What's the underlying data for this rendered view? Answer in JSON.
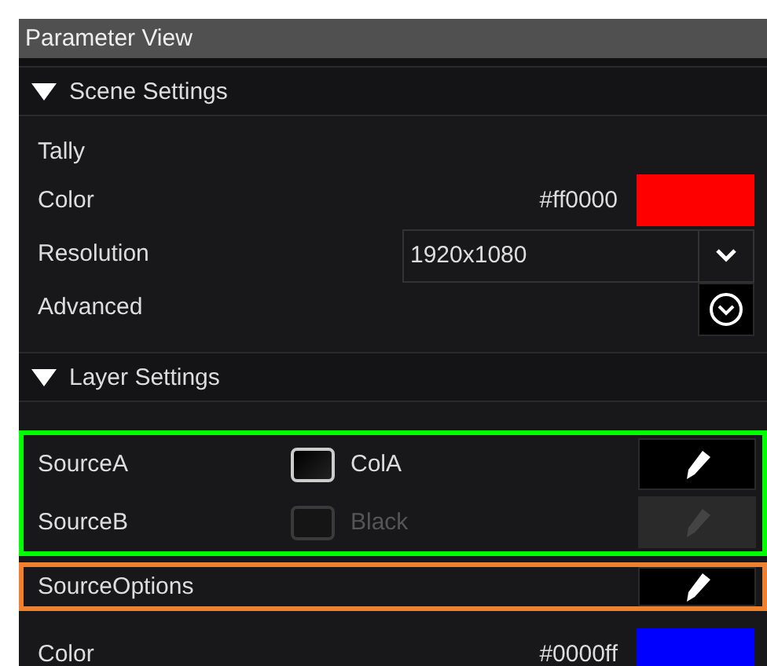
{
  "panel_title": "Parameter View",
  "sections": [
    {
      "title": "Scene Settings",
      "expanded": true,
      "rows": [
        {
          "kind": "label",
          "label": "Tally"
        },
        {
          "kind": "color",
          "label": "Color",
          "value": "#ff0000",
          "color": "#ff0000"
        },
        {
          "kind": "select",
          "label": "Resolution",
          "value": "1920x1080"
        },
        {
          "kind": "toggle",
          "label": "Advanced"
        }
      ]
    },
    {
      "title": "Layer Settings",
      "expanded": true,
      "rows": [
        {
          "kind": "group",
          "color": "#00ff00",
          "rows": [
            {
              "kind": "source",
              "label": "SourceA",
              "checked": false,
              "disabled": false,
              "value": "ColA"
            },
            {
              "kind": "source",
              "label": "SourceB",
              "checked": false,
              "disabled": true,
              "value": "Black"
            }
          ]
        },
        {
          "kind": "group",
          "color": "#f08030",
          "rows": [
            {
              "kind": "edit",
              "label": "SourceOptions"
            }
          ]
        },
        {
          "kind": "color",
          "label": "Color",
          "value": "#0000ff",
          "color": "#0000ff"
        }
      ]
    }
  ]
}
